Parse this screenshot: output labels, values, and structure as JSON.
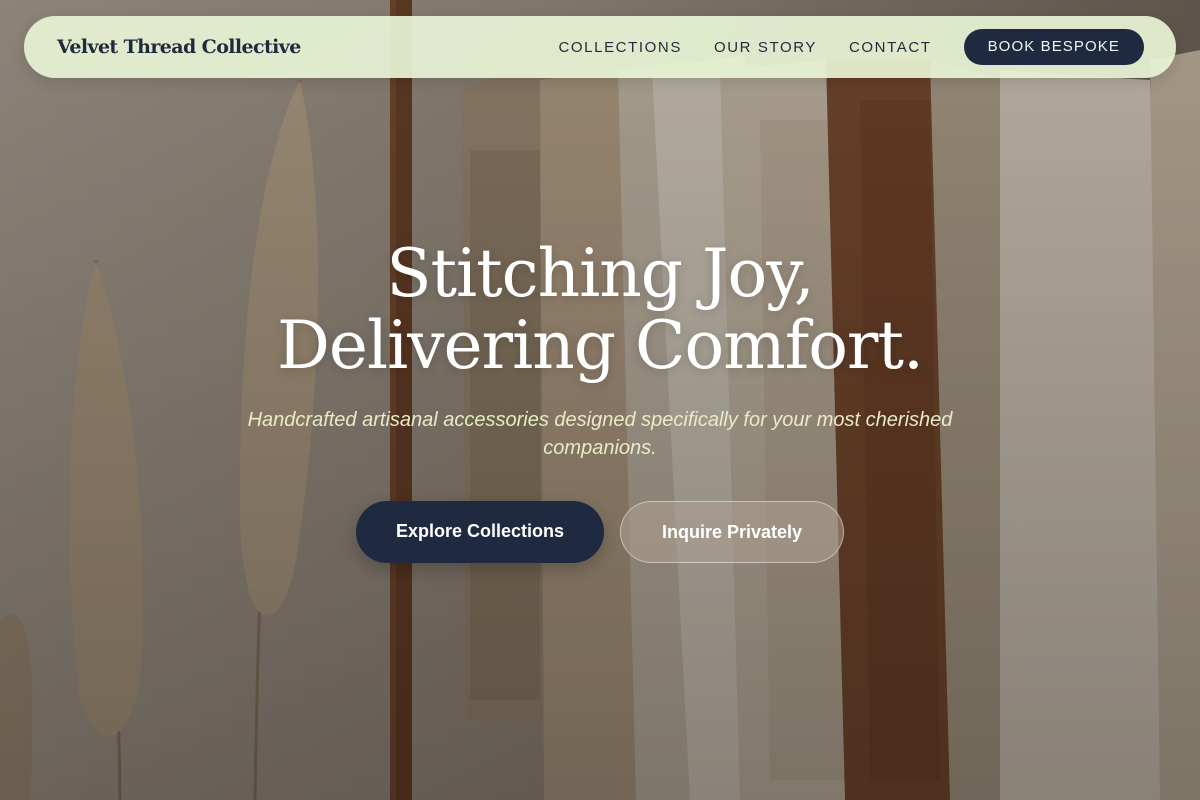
{
  "nav": {
    "brand": "Velvet Thread Collective",
    "links": [
      {
        "label": "COLLECTIONS"
      },
      {
        "label": "OUR STORY"
      },
      {
        "label": "CONTACT"
      }
    ],
    "cta_label": "BOOK BESPOKE"
  },
  "hero": {
    "headline_line1": "Stitching Joy,",
    "headline_line2": "Delivering Comfort.",
    "subtitle": "Handcrafted artisanal accessories designed specifically for your most cherished companions.",
    "primary_button": "Explore Collections",
    "secondary_button": "Inquire Privately",
    "background_image": "clothing rack with knit sweaters and dried pampas grass"
  },
  "colors": {
    "navy": "#1f2a40",
    "nav_background": "#e7f2d4",
    "subtitle_tint": "#e7ebc6"
  }
}
